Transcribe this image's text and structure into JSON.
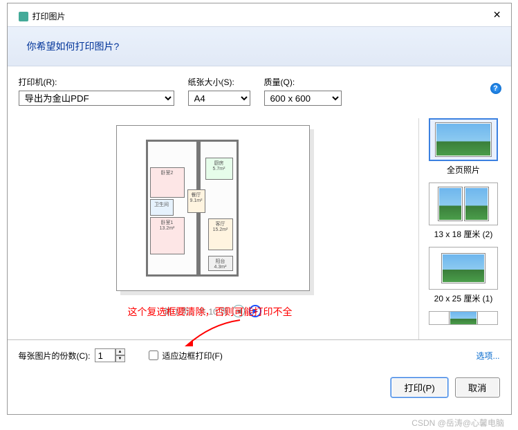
{
  "window": {
    "title": "打印图片"
  },
  "banner": {
    "question": "你希望如何打印图片?"
  },
  "labels": {
    "printer": "打印机(R):",
    "paper_size": "纸张大小(S):",
    "quality": "质量(Q):"
  },
  "selects": {
    "printer_value": "导出为金山PDF",
    "paper_value": "A4",
    "quality_value": "600 x 600"
  },
  "pager": {
    "text": "第 1 页，共 10 页"
  },
  "annotation": {
    "text": "这个复选框要清除，否则可能打印不全"
  },
  "layouts": {
    "full": "全页照片",
    "l13x18": "13 x 18 厘米 (2)",
    "l20x25": "20 x 25 厘米 (1)"
  },
  "bottom": {
    "copies_label": "每张图片的份数(C):",
    "copies_value": "1",
    "fit_frame": "适应边框打印(F)",
    "options_link": "选项..."
  },
  "buttons": {
    "print": "打印(P)",
    "cancel": "取消"
  },
  "watermark": "CSDN @岳涛@心馨电脑"
}
